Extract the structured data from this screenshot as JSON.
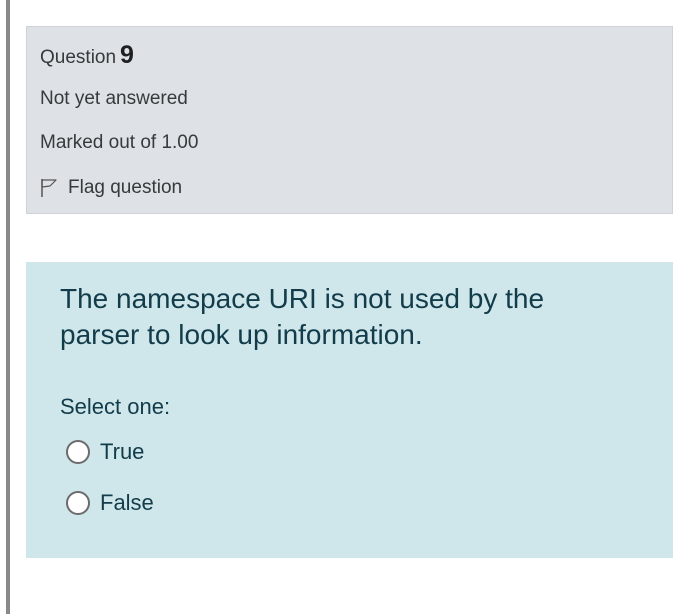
{
  "question": {
    "label": "Question",
    "number": "9",
    "state": "Not yet answered",
    "grade": "Marked out of 1.00",
    "flag_label": "Flag question",
    "flag_icon": "flag-outline-icon"
  },
  "content": {
    "question_text": "The namespace URI is not used by the parser to look up information.",
    "prompt": "Select one:",
    "options": [
      {
        "label": "True",
        "selected": false
      },
      {
        "label": "False",
        "selected": false
      }
    ]
  },
  "colors": {
    "info_background": "#dee2e6",
    "content_background": "#cfe6eb",
    "text_primary": "#123c4a"
  }
}
